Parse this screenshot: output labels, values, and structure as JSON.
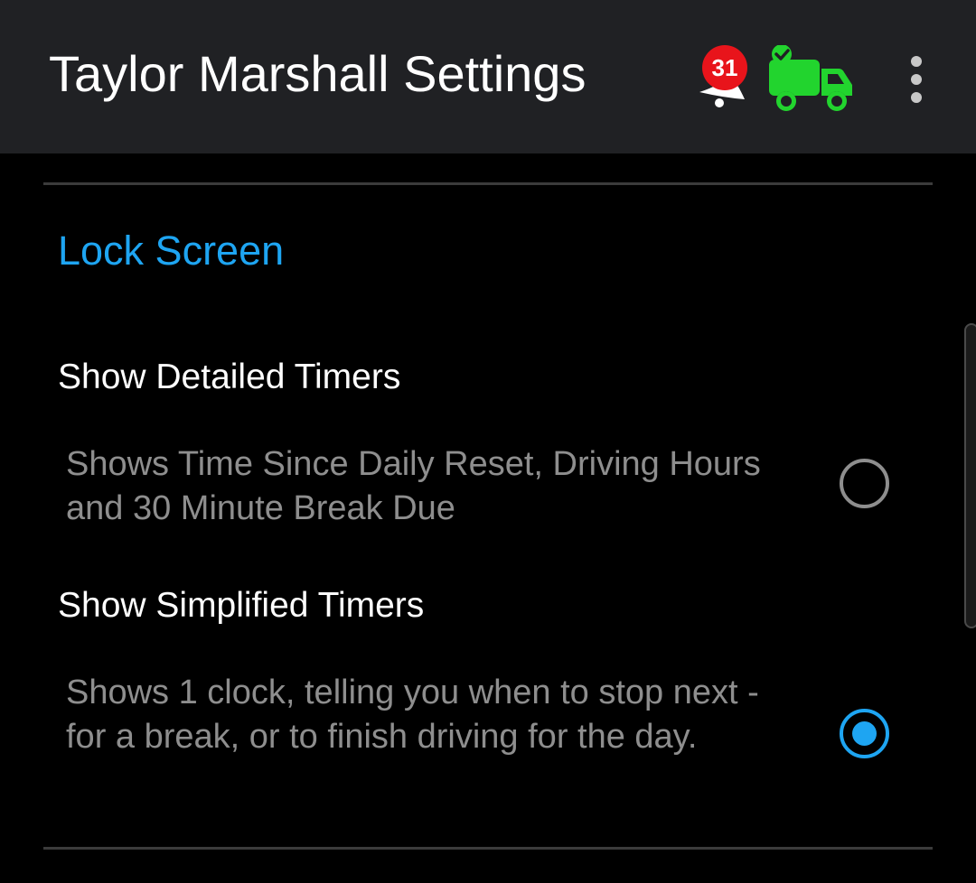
{
  "app_bar": {
    "title": "Taylor Marshall Settings",
    "notifications": {
      "count": "31",
      "icon": "notification-bell-icon",
      "badge_color": "#e8141b"
    },
    "status_icon": {
      "icon": "truck-check-icon",
      "color": "#22d42e"
    },
    "overflow_icon": "more-vert-icon"
  },
  "section": {
    "title": "Lock Screen",
    "accent_color": "#1ea5f2"
  },
  "options": [
    {
      "title": "Show Detailed Timers",
      "description": "Shows Time Since Daily Reset, Driving Hours and 30 Minute Break Due",
      "selected": false
    },
    {
      "title": "Show Simplified Timers",
      "description": "Shows 1 clock, telling you when to stop next - for a break, or to finish driving for the day.",
      "selected": true
    }
  ]
}
